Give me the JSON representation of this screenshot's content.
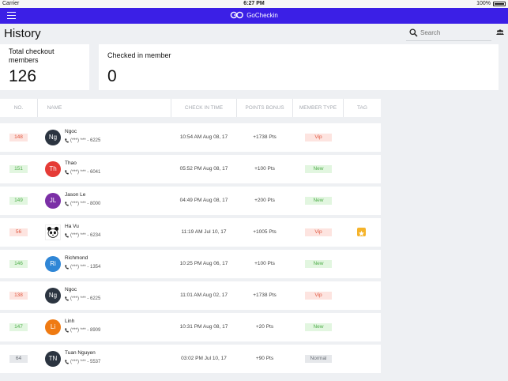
{
  "status_bar": {
    "carrier": "Carrier",
    "time": "6:27 PM",
    "battery": "100%"
  },
  "nav": {
    "brand": "GoCheckin",
    "brand_color": "#3b1fe6"
  },
  "page": {
    "title": "History"
  },
  "search": {
    "placeholder": "Search",
    "value": ""
  },
  "stats": {
    "total_label": "Total checkout members",
    "total_value": "126",
    "checked_label": "Checked in member",
    "checked_value": "0"
  },
  "table": {
    "columns": [
      "NO.",
      "NAME",
      "CHECK IN TIME",
      "POINTS BONUS",
      "MEMBER TYPE",
      "TAG"
    ],
    "rows": [
      {
        "no": "148",
        "initials": "Ng",
        "avatar_color": "#2b3440",
        "name": "Ngoc",
        "phone": "(***) *** - 6225",
        "time": "10:54 AM Aug 08, 17",
        "points": "+1738 Pts",
        "type": "Vip",
        "starred": false
      },
      {
        "no": "151",
        "initials": "Th",
        "avatar_color": "#e53b36",
        "name": "Thao",
        "phone": "(***) *** - 6041",
        "time": "05:52 PM Aug 08, 17",
        "points": "+100 Pts",
        "type": "New",
        "starred": false
      },
      {
        "no": "149",
        "initials": "JL",
        "avatar_color": "#7b2fa6",
        "name": "Jason Le",
        "phone": "(***) *** - 8000",
        "time": "04:49 PM Aug 08, 17",
        "points": "+200 Pts",
        "type": "New",
        "starred": false
      },
      {
        "no": "56",
        "initials": "",
        "avatar_color": "panda",
        "name": "Ha Vu",
        "phone": "(***) *** - 6234",
        "time": "11:19 AM Jul 10, 17",
        "points": "+1005 Pts",
        "type": "Vip",
        "starred": true
      },
      {
        "no": "146",
        "initials": "Ri",
        "avatar_color": "#2f86d6",
        "name": "Richmond",
        "phone": "(***) *** - 1354",
        "time": "10:25 PM Aug 06, 17",
        "points": "+100 Pts",
        "type": "New",
        "starred": false
      },
      {
        "no": "138",
        "initials": "Ng",
        "avatar_color": "#2b3440",
        "name": "Ngoc",
        "phone": "(***) *** - 6225",
        "time": "11:01 AM Aug 02, 17",
        "points": "+1738 Pts",
        "type": "Vip",
        "starred": false
      },
      {
        "no": "147",
        "initials": "Li",
        "avatar_color": "#ef7a12",
        "name": "Linh",
        "phone": "(***) *** - 8909",
        "time": "10:31 PM Aug 08, 17",
        "points": "+20 Pts",
        "type": "New",
        "starred": false
      },
      {
        "no": "64",
        "initials": "TN",
        "avatar_color": "#2b3440",
        "name": "Tuan Nguyen",
        "phone": "(***) *** - 5537",
        "time": "03:02 PM Jul 10, 17",
        "points": "+90 Pts",
        "type": "Normal",
        "starred": false
      }
    ]
  },
  "badge_colors": {
    "Vip": {
      "bg": "#fde4e0",
      "fg": "#e0573f"
    },
    "New": {
      "bg": "#e2f6e0",
      "fg": "#4fae4a"
    },
    "Normal": {
      "bg": "#e6e8eb",
      "fg": "#6b7077"
    }
  }
}
